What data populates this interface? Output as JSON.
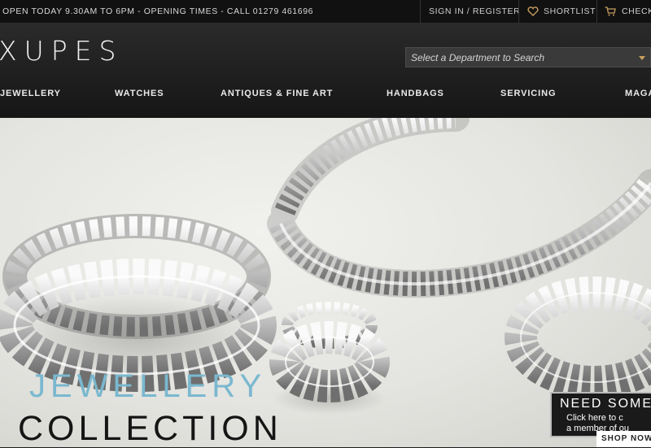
{
  "topbar": {
    "info": "OPEN TODAY 9.30AM TO 6PM - OPENING TIMES - CALL 01279 461696",
    "sign_in": "SIGN IN / REGISTER",
    "shortlist": "SHORTLIST",
    "checkout": "CHECK"
  },
  "header": {
    "logo": "XUPES",
    "department_placeholder": "Select a Department to Search"
  },
  "nav": {
    "items": [
      "JEWELLERY",
      "WATCHES",
      "ANTIQUES & FINE ART",
      "HANDBAGS",
      "SERVICING",
      "MAGA"
    ]
  },
  "hero": {
    "title_line1": "JEWELLERY",
    "title_line2": "COLLECTION",
    "promo_heading": "NEED SOME",
    "promo_line1": "Click here to c",
    "promo_line2": "a member of ou",
    "shop_now": "SHOP NOW"
  },
  "colors": {
    "accent_gold": "#c8a060",
    "hero_title_blue": "#7ab8cf"
  },
  "icons": [
    "heart-icon",
    "cart-icon",
    "chevron-down-icon"
  ]
}
